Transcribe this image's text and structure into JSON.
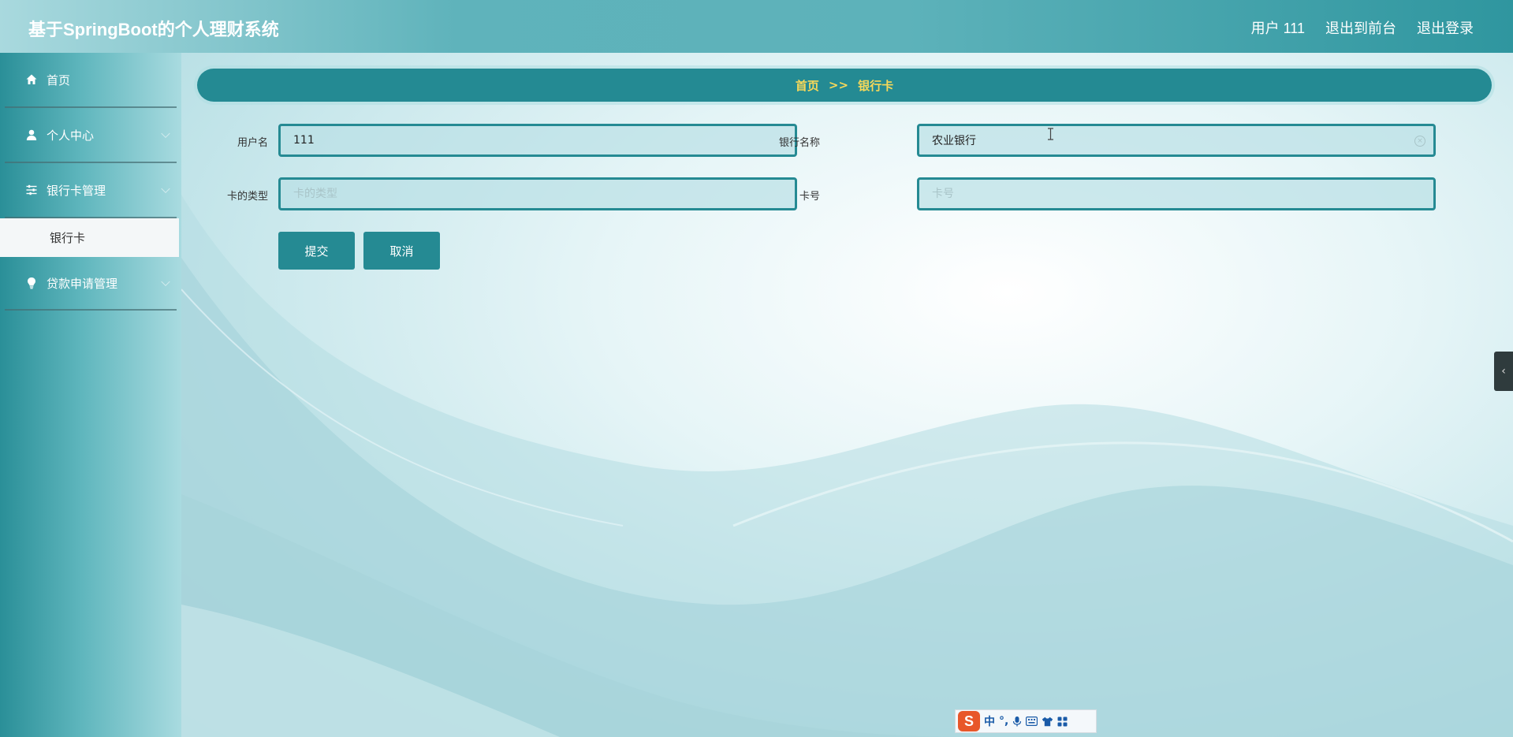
{
  "header": {
    "app_title": "基于SpringBoot的个人理财系统",
    "user_label": "用户 111",
    "back_to_front_label": "退出到前台",
    "logout_label": "退出登录"
  },
  "sidebar": {
    "items": [
      {
        "label": "首页",
        "icon": "home-icon"
      },
      {
        "label": "个人中心",
        "icon": "user-icon"
      },
      {
        "label": "银行卡管理",
        "icon": "sliders-icon",
        "subitems": [
          {
            "label": "银行卡",
            "active": true
          }
        ]
      },
      {
        "label": "贷款申请管理",
        "icon": "lightbulb-icon"
      }
    ]
  },
  "breadcrumb": {
    "home": "首页",
    "separator": ">>",
    "current": "银行卡"
  },
  "form": {
    "username": {
      "label": "用户名",
      "value": "111",
      "placeholder": ""
    },
    "bank_name": {
      "label": "银行名称",
      "value": "农业银行",
      "placeholder": ""
    },
    "card_type": {
      "label": "卡的类型",
      "value": "",
      "placeholder": "卡的类型"
    },
    "card_number": {
      "label": "卡号",
      "value": "",
      "placeholder": "卡号"
    },
    "submit_label": "提交",
    "cancel_label": "取消"
  },
  "ime_toolbar": {
    "logo": "S",
    "mode": "中",
    "punct": "°,"
  },
  "colors": {
    "accent": "#258a93",
    "breadcrumb_text": "#f6d85a"
  }
}
